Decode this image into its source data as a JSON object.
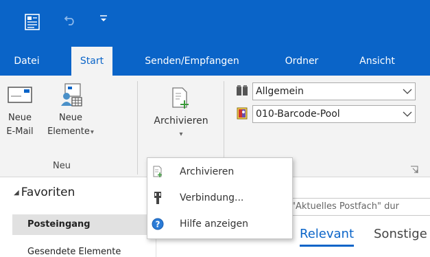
{
  "colors": {
    "accent": "#0a64c8",
    "ribbon_bg": "#f3f3f3",
    "selected_row": "#e1e1e1"
  },
  "quick_access": {
    "icons": [
      "outlook-app-icon",
      "undo-icon",
      "customize-quick-access-icon"
    ]
  },
  "tabs": [
    {
      "label": "Datei",
      "active": false
    },
    {
      "label": "Start",
      "active": true
    },
    {
      "label": "Senden/Empfangen",
      "active": false
    },
    {
      "label": "Ordner",
      "active": false
    },
    {
      "label": "Ansicht",
      "active": false
    }
  ],
  "ribbon": {
    "new_group": {
      "new_email": {
        "line1": "Neue",
        "line2": "E-Mail",
        "icon": "envelope-icon"
      },
      "new_items": {
        "line1": "Neue",
        "line2": "Elemente",
        "arrow": "▾",
        "icon": "new-items-icon"
      },
      "label": "Neu"
    },
    "archive": {
      "label": "Archivieren",
      "arrow": "▾",
      "icon": "archive-icon"
    },
    "combos": [
      {
        "value": "Allgemein",
        "icon": "address-book-icon"
      },
      {
        "value": "010-Barcode-Pool",
        "icon": "contact-list-icon"
      }
    ],
    "dialog_launcher_icon": "dialog-launcher-icon"
  },
  "archive_menu": [
    {
      "label": "Archivieren",
      "icon": "archive-icon"
    },
    {
      "label": "Verbindung...",
      "icon": "plug-icon"
    },
    {
      "label": "Hilfe anzeigen",
      "icon": "help-icon"
    }
  ],
  "nav": {
    "favorites": "Favoriten",
    "favorites_arrow": "◢",
    "folders": [
      {
        "label": "Posteingang",
        "selected": true
      },
      {
        "label": "Gesendete Elemente",
        "selected": false
      }
    ]
  },
  "search": {
    "placeholder": "\"Aktuelles Postfach\" dur"
  },
  "filter_tabs": [
    {
      "label": "Relevant",
      "active": true
    },
    {
      "label": "Sonstige",
      "active": false
    }
  ]
}
